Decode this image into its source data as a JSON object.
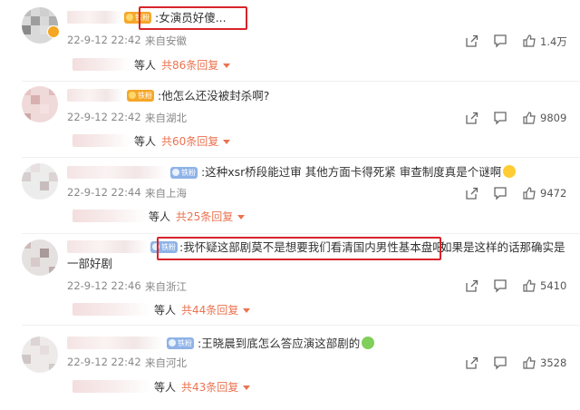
{
  "comments": [
    {
      "badge": "铁粉",
      "text": ":女演员好傻...",
      "date": "22-9-12 22:42",
      "location": "来自安徽",
      "likes": "1.4万",
      "reply_people": "等人",
      "reply_count": "共86条回复"
    },
    {
      "badge": "铁粉",
      "text": ":他怎么还没被封杀啊?",
      "date": "22-9-12 22:42",
      "location": "来自湖北",
      "likes": "9809",
      "reply_people": "等人",
      "reply_count": "共60条回复"
    },
    {
      "badge": "铁粉",
      "text": ":这种xsr桥段能过审 其他方面卡得死紧 审查制度真是个谜啊",
      "date": "22-9-12 22:44",
      "location": "来自上海",
      "likes": "9472",
      "reply_people": "等人",
      "reply_count": "共25条回复"
    },
    {
      "badge": "铁粉",
      "text_highlight": ":我怀疑这部剧莫不是想要我们看清国内男性基本盘吧",
      "text_rest": " 如果是这样的话那确实是",
      "text_line2": "一部好剧",
      "date": "22-9-12 22:46",
      "location": "来自浙江",
      "likes": "5410",
      "reply_people": "等人",
      "reply_count": "共44条回复"
    },
    {
      "badge": "铁粉",
      "text": ":王晓晨到底怎么答应演这部剧的",
      "date": "22-9-12 22:42",
      "location": "来自河北",
      "likes": "3528",
      "reply_people": "等人",
      "reply_count": "共43条回复"
    }
  ],
  "colors": {
    "accent_orange": "#eb7350",
    "highlight_box": "#d9242b",
    "meta_gray": "#888888",
    "badge_blue": "#8fb3e6",
    "badge_gold": "#f5a72a"
  },
  "icons": {
    "share": "share-icon",
    "comment": "comment-icon",
    "like": "thumbs-up-icon",
    "expand": "chevron-down-icon",
    "vip": "vip-badge-icon",
    "emoji_surprised": "surprised-emoji-icon",
    "emoji_frog": "frog-emoji-icon"
  }
}
